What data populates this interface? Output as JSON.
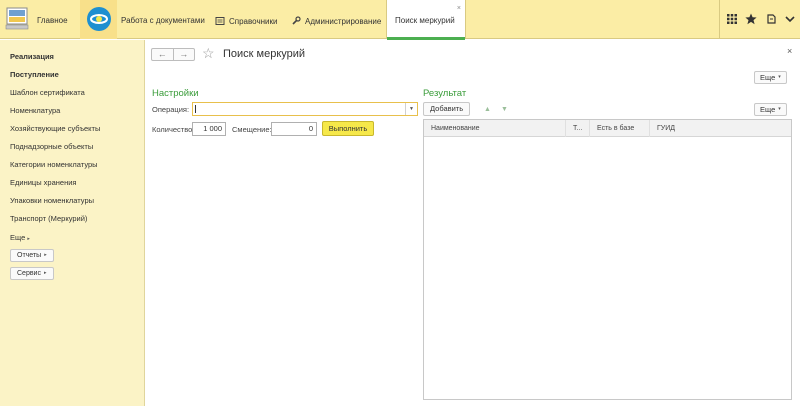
{
  "header": {
    "home_label": "Главное",
    "sections": [
      {
        "label": "Работа с документами",
        "icon": "documents-icon"
      },
      {
        "label": "Справочники",
        "icon": "catalog-icon"
      },
      {
        "label": "Администрирование",
        "icon": "wrench-icon"
      }
    ],
    "active_tab": {
      "label": "Поиск меркурий",
      "close": "×"
    },
    "right_icons": [
      "grid-icon",
      "star-icon",
      "history-icon",
      "chevron-down-icon"
    ]
  },
  "sidebar": {
    "items": [
      {
        "label": "Реализация",
        "bold": true
      },
      {
        "label": "Поступление",
        "bold": true
      },
      {
        "label": "Шаблон сертификата",
        "bold": false
      },
      {
        "label": "Номенклатура",
        "bold": false
      },
      {
        "label": "Хозяйствующие субъекты",
        "bold": false
      },
      {
        "label": "Поднадзорные объекты",
        "bold": false
      },
      {
        "label": "Категории номенклатуры",
        "bold": false
      },
      {
        "label": "Единицы хранения",
        "bold": false
      },
      {
        "label": "Упаковки номенклатуры",
        "bold": false
      },
      {
        "label": "Транспорт (Меркурий)",
        "bold": false
      }
    ],
    "more_label": "Еще",
    "reports_label": "Отчеты",
    "service_label": "Сервис"
  },
  "form": {
    "title": "Поиск меркурий",
    "close": "×",
    "more_label": "Еще",
    "settings": {
      "title": "Настройки",
      "operation_label": "Операция:",
      "operation_value": "",
      "quantity_label": "Количество:",
      "quantity_value": "1 000",
      "offset_label": "Смещение:",
      "offset_value": "0",
      "run_label": "Выполнить"
    },
    "result": {
      "title": "Результат",
      "add_label": "Добавить",
      "more_label": "Еще",
      "columns": [
        "Наименование",
        "Т...",
        "Есть в базе",
        "ГУИД"
      ],
      "rows": []
    }
  },
  "colors": {
    "topbar": "#fbeda5",
    "sidebar": "#fbf3c6",
    "group_title": "#3a9c3a",
    "run_button": "#f6e84a",
    "active_tab_underline": "#4caf50"
  }
}
